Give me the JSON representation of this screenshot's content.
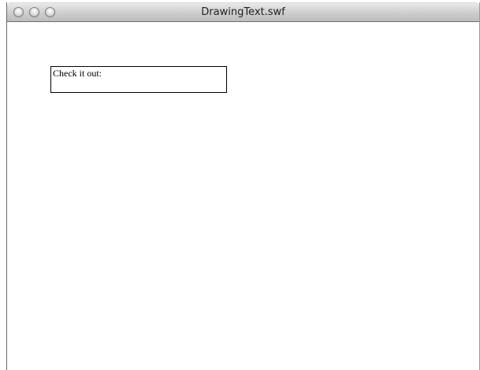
{
  "window": {
    "title": "DrawingText.swf"
  },
  "content": {
    "text_field_value": "Check it out:"
  }
}
